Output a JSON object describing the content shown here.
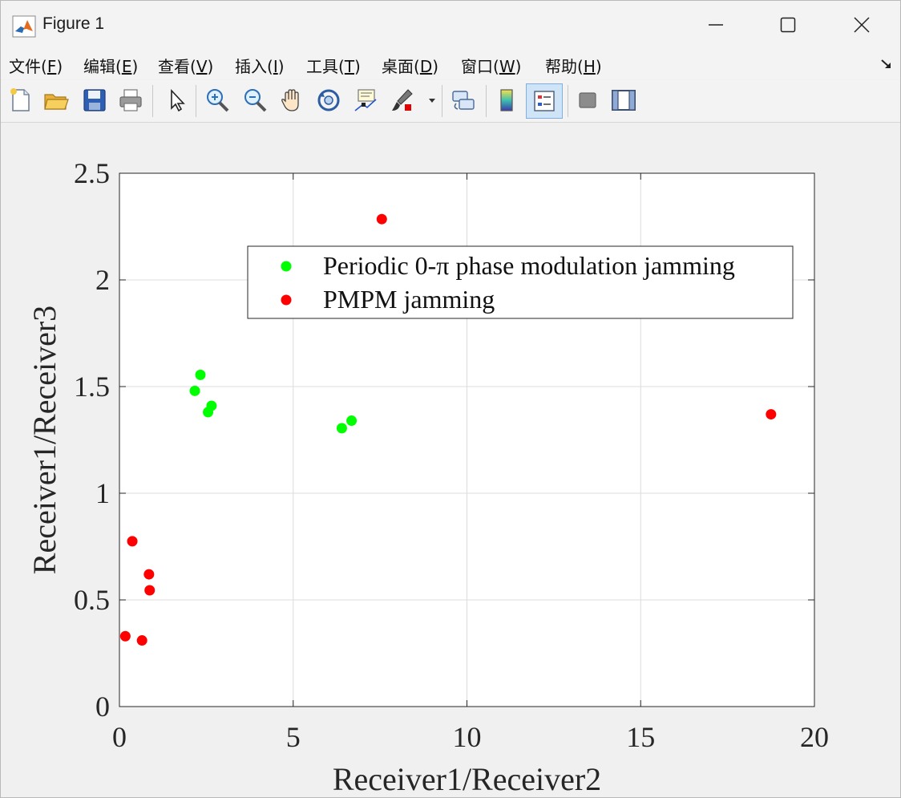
{
  "window": {
    "title": "Figure 1"
  },
  "menu": {
    "items": [
      {
        "label": "文件(",
        "key": "F",
        "end": ")"
      },
      {
        "label": "编辑(",
        "key": "E",
        "end": ")"
      },
      {
        "label": "查看(",
        "key": "V",
        "end": ")"
      },
      {
        "label": "插入(",
        "key": "I",
        "end": ")"
      },
      {
        "label": "工具(",
        "key": "T",
        "end": ")"
      },
      {
        "label": "桌面(",
        "key": "D",
        "end": ")"
      },
      {
        "label": "窗口(",
        "key": "W",
        "end": ")"
      },
      {
        "label": "帮助(",
        "key": "H",
        "end": ")"
      }
    ]
  },
  "toolbar": {
    "icons": [
      "new-figure-icon",
      "open-file-icon",
      "save-icon",
      "print-icon",
      "pointer-icon",
      "zoom-in-icon",
      "zoom-out-icon",
      "pan-icon",
      "rotate-3d-icon",
      "data-cursor-icon",
      "brush-icon",
      "link-plot-icon",
      "colorbar-icon",
      "legend-icon",
      "hide-plot-tools-icon",
      "show-plot-tools-icon"
    ]
  },
  "colors": {
    "green": "#00ff00",
    "red": "#ff0000",
    "axis": "#262626",
    "grid": "#dcdcdc"
  },
  "chart_data": {
    "type": "scatter",
    "xlabel": "Receiver1/Receiver2",
    "ylabel": "Receiver1/Receiver3",
    "xlim": [
      0,
      20
    ],
    "ylim": [
      0,
      2.5
    ],
    "xticks": [
      0,
      5,
      10,
      15,
      20
    ],
    "xtick_labels": [
      "0",
      "5",
      "10",
      "15",
      "20"
    ],
    "yticks": [
      0,
      0.5,
      1,
      1.5,
      2,
      2.5
    ],
    "ytick_labels": [
      "0",
      "0.5",
      "1",
      "1.5",
      "2",
      "2.5"
    ],
    "grid": true,
    "legend_position": "upper-right",
    "series": [
      {
        "name": "Periodic 0-π phase modulation jamming",
        "color": "#00ff00",
        "points": [
          [
            2.17,
            1.48
          ],
          [
            2.33,
            1.555
          ],
          [
            2.55,
            1.38
          ],
          [
            2.65,
            1.41
          ],
          [
            6.4,
            1.305
          ],
          [
            6.68,
            1.34
          ]
        ]
      },
      {
        "name": "PMPM jamming",
        "color": "#ff0000",
        "points": [
          [
            7.55,
            2.285
          ],
          [
            18.75,
            1.37
          ],
          [
            0.37,
            0.775
          ],
          [
            0.85,
            0.62
          ],
          [
            0.87,
            0.545
          ],
          [
            0.17,
            0.33
          ],
          [
            0.65,
            0.31
          ]
        ]
      }
    ]
  }
}
